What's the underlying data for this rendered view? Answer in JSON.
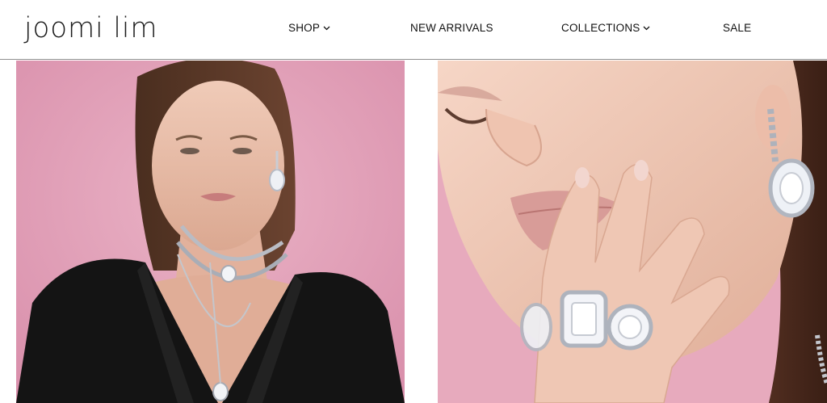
{
  "brand": {
    "name": "JOOMI LIM",
    "logo_text": "joomi lim"
  },
  "nav": {
    "items": [
      {
        "label": "SHOP",
        "has_dropdown": true
      },
      {
        "label": "NEW ARRIVALS",
        "has_dropdown": false
      },
      {
        "label": "COLLECTIONS",
        "has_dropdown": true
      },
      {
        "label": "SALE",
        "has_dropdown": false
      }
    ]
  },
  "colors": {
    "background": "#ffffff",
    "text": "#111111",
    "divider": "#8f8f8f",
    "hero_pink": "#e3a4bb"
  },
  "hero": {
    "left_image": "model-with-crystal-necklaces-and-earrings",
    "right_image": "model-with-crystal-cocktail-rings-closeup"
  }
}
